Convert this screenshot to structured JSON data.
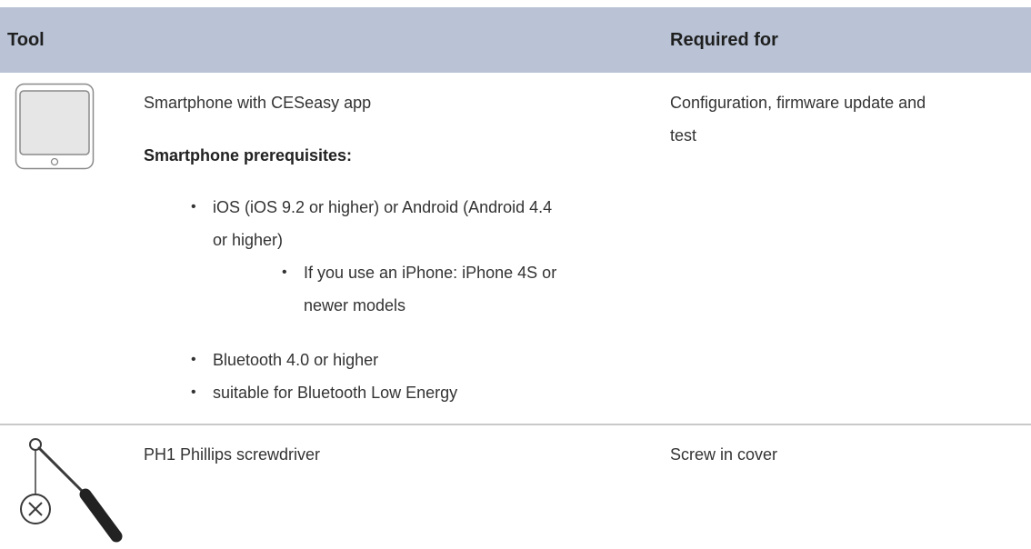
{
  "table": {
    "headers": {
      "tool": "Tool",
      "required_for": "Required for"
    },
    "rows": [
      {
        "icon": "smartphone-icon",
        "tool": "Smartphone with CESeasy app",
        "prerequisites_heading": "Smartphone prerequisites:",
        "prerequisites": {
          "ios_android_line1": "iOS (iOS 9.2 or higher) or Android (Android 4.4",
          "ios_android_line2": "or higher)",
          "iphone_line1": "If you use an iPhone: iPhone 4S or",
          "iphone_line2": "newer models",
          "bluetooth": "Bluetooth 4.0 or higher",
          "ble": "suitable for Bluetooth Low Energy"
        },
        "required_line1": "Configuration, firmware update and",
        "required_line2": "test"
      },
      {
        "icon": "screwdriver-icon",
        "tool": "PH1 Phillips screwdriver",
        "required_for": "Screw in cover"
      }
    ]
  },
  "colors": {
    "header_bg": "#b9c3d5",
    "divider": "#c9c9c9",
    "text": "#333333"
  }
}
